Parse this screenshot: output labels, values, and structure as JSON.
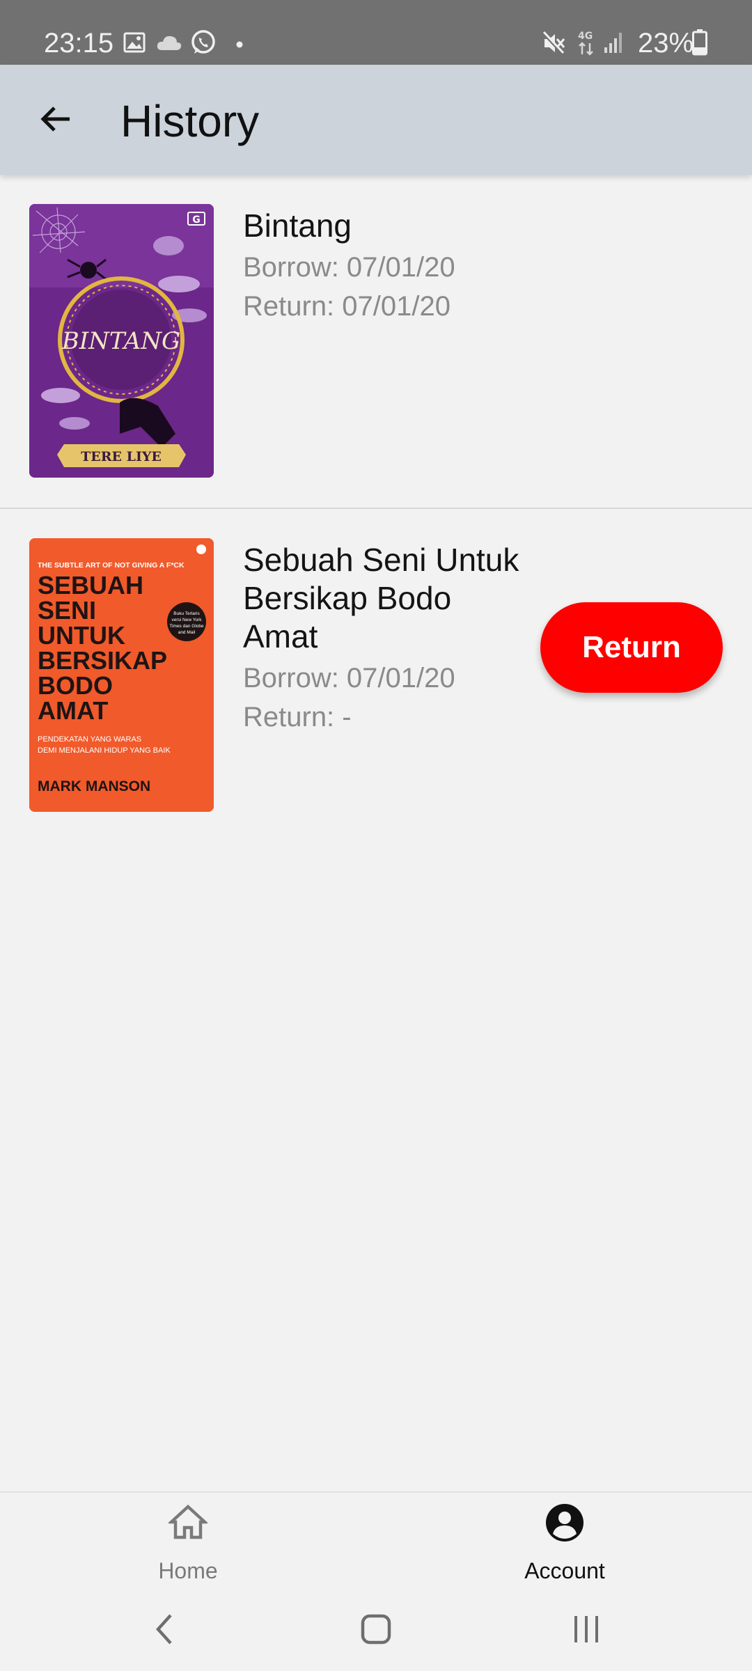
{
  "status_bar": {
    "time": "23:15",
    "battery": "23%",
    "icons": [
      "gallery-icon",
      "cloud-icon",
      "whatsapp-icon",
      "dot-icon",
      "mute-icon",
      "network-4g-icon",
      "signal-icon",
      "battery-icon"
    ]
  },
  "app_bar": {
    "title": "History",
    "back_icon": "arrow-back-icon"
  },
  "history": [
    {
      "title": "Bintang",
      "borrow": "Borrow: 07/01/20",
      "return": "Return: 07/01/20",
      "cover": {
        "title_text": "BINTANG",
        "author_text": "TERE LIYE",
        "publisher_mark": "G",
        "background": "#6e2a8c"
      }
    },
    {
      "title": "Sebuah Seni Untuk Bersikap Bodo Amat",
      "borrow": "Borrow: 07/01/20",
      "return": "Return: -",
      "return_button": "Return",
      "cover": {
        "tagline": "THE SUBTLE ART OF NOT GIVING A F*CK",
        "title_lines": [
          "SEBUAH",
          "SENI",
          "UNTUK",
          "BERSIKAP",
          "BODO",
          "AMAT"
        ],
        "subtitle_lines": [
          "PENDEKATAN YANG WARAS",
          "DEMI MENJALANI HIDUP YANG BAIK"
        ],
        "author": "MARK MANSON",
        "badge": "Buku Terlaris versi New York Times dan Globe and Mail",
        "background": "#f15a2b"
      }
    }
  ],
  "bottom_nav": {
    "items": [
      {
        "label": "Home",
        "icon": "home-icon",
        "active": false
      },
      {
        "label": "Account",
        "icon": "account-icon",
        "active": true
      }
    ]
  },
  "colors": {
    "status_bar": "#717171",
    "app_bar": "#ccd3da",
    "background": "#f2f2f2",
    "return_button": "#ff0000"
  }
}
